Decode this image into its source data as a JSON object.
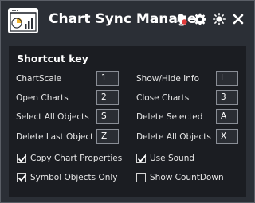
{
  "window": {
    "title": "Chart Sync Manager"
  },
  "titlebar_icons": [
    "bell-icon",
    "gear-icon",
    "sun-icon",
    "close-icon"
  ],
  "section": {
    "title": "Shortcut key"
  },
  "shortcuts": {
    "chart_scale": {
      "label": "ChartScale",
      "key": "1"
    },
    "open_charts": {
      "label": "Open Charts",
      "key": "2"
    },
    "select_all_objects": {
      "label": "Select All Objects",
      "key": "S"
    },
    "delete_last_object": {
      "label": "Delete Last Object",
      "key": "Z"
    },
    "show_hide_info": {
      "label": "Show/Hide Info",
      "key": "I"
    },
    "close_charts": {
      "label": "Close Charts",
      "key": "3"
    },
    "delete_selected": {
      "label": "Delete Selected",
      "key": "A"
    },
    "delete_all_objects": {
      "label": "Delete All Objects",
      "key": "X"
    }
  },
  "options": {
    "copy_chart_properties": {
      "label": "Copy Chart Properties",
      "checked": true
    },
    "symbol_objects_only": {
      "label": "Symbol Objects Only",
      "checked": true
    },
    "use_sound": {
      "label": "Use Sound",
      "checked": true
    },
    "show_countdown": {
      "label": "Show CountDown",
      "checked": false
    }
  },
  "colors": {
    "window_bg": "#2b2f36",
    "panel_bg": "#1b1d22",
    "text": "#e6e6e6",
    "accent_red": "#e03a3a",
    "accent_yellow": "#f2b632"
  }
}
